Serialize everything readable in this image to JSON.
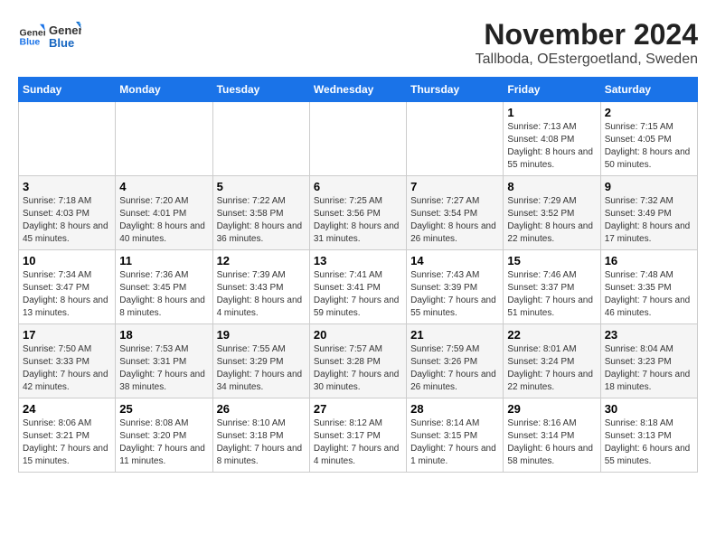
{
  "header": {
    "logo_line1": "General",
    "logo_line2": "Blue",
    "month": "November 2024",
    "location": "Tallboda, OEstergoetland, Sweden"
  },
  "weekdays": [
    "Sunday",
    "Monday",
    "Tuesday",
    "Wednesday",
    "Thursday",
    "Friday",
    "Saturday"
  ],
  "weeks": [
    [
      {
        "day": "",
        "info": ""
      },
      {
        "day": "",
        "info": ""
      },
      {
        "day": "",
        "info": ""
      },
      {
        "day": "",
        "info": ""
      },
      {
        "day": "",
        "info": ""
      },
      {
        "day": "1",
        "info": "Sunrise: 7:13 AM\nSunset: 4:08 PM\nDaylight: 8 hours and 55 minutes."
      },
      {
        "day": "2",
        "info": "Sunrise: 7:15 AM\nSunset: 4:05 PM\nDaylight: 8 hours and 50 minutes."
      }
    ],
    [
      {
        "day": "3",
        "info": "Sunrise: 7:18 AM\nSunset: 4:03 PM\nDaylight: 8 hours and 45 minutes."
      },
      {
        "day": "4",
        "info": "Sunrise: 7:20 AM\nSunset: 4:01 PM\nDaylight: 8 hours and 40 minutes."
      },
      {
        "day": "5",
        "info": "Sunrise: 7:22 AM\nSunset: 3:58 PM\nDaylight: 8 hours and 36 minutes."
      },
      {
        "day": "6",
        "info": "Sunrise: 7:25 AM\nSunset: 3:56 PM\nDaylight: 8 hours and 31 minutes."
      },
      {
        "day": "7",
        "info": "Sunrise: 7:27 AM\nSunset: 3:54 PM\nDaylight: 8 hours and 26 minutes."
      },
      {
        "day": "8",
        "info": "Sunrise: 7:29 AM\nSunset: 3:52 PM\nDaylight: 8 hours and 22 minutes."
      },
      {
        "day": "9",
        "info": "Sunrise: 7:32 AM\nSunset: 3:49 PM\nDaylight: 8 hours and 17 minutes."
      }
    ],
    [
      {
        "day": "10",
        "info": "Sunrise: 7:34 AM\nSunset: 3:47 PM\nDaylight: 8 hours and 13 minutes."
      },
      {
        "day": "11",
        "info": "Sunrise: 7:36 AM\nSunset: 3:45 PM\nDaylight: 8 hours and 8 minutes."
      },
      {
        "day": "12",
        "info": "Sunrise: 7:39 AM\nSunset: 3:43 PM\nDaylight: 8 hours and 4 minutes."
      },
      {
        "day": "13",
        "info": "Sunrise: 7:41 AM\nSunset: 3:41 PM\nDaylight: 7 hours and 59 minutes."
      },
      {
        "day": "14",
        "info": "Sunrise: 7:43 AM\nSunset: 3:39 PM\nDaylight: 7 hours and 55 minutes."
      },
      {
        "day": "15",
        "info": "Sunrise: 7:46 AM\nSunset: 3:37 PM\nDaylight: 7 hours and 51 minutes."
      },
      {
        "day": "16",
        "info": "Sunrise: 7:48 AM\nSunset: 3:35 PM\nDaylight: 7 hours and 46 minutes."
      }
    ],
    [
      {
        "day": "17",
        "info": "Sunrise: 7:50 AM\nSunset: 3:33 PM\nDaylight: 7 hours and 42 minutes."
      },
      {
        "day": "18",
        "info": "Sunrise: 7:53 AM\nSunset: 3:31 PM\nDaylight: 7 hours and 38 minutes."
      },
      {
        "day": "19",
        "info": "Sunrise: 7:55 AM\nSunset: 3:29 PM\nDaylight: 7 hours and 34 minutes."
      },
      {
        "day": "20",
        "info": "Sunrise: 7:57 AM\nSunset: 3:28 PM\nDaylight: 7 hours and 30 minutes."
      },
      {
        "day": "21",
        "info": "Sunrise: 7:59 AM\nSunset: 3:26 PM\nDaylight: 7 hours and 26 minutes."
      },
      {
        "day": "22",
        "info": "Sunrise: 8:01 AM\nSunset: 3:24 PM\nDaylight: 7 hours and 22 minutes."
      },
      {
        "day": "23",
        "info": "Sunrise: 8:04 AM\nSunset: 3:23 PM\nDaylight: 7 hours and 18 minutes."
      }
    ],
    [
      {
        "day": "24",
        "info": "Sunrise: 8:06 AM\nSunset: 3:21 PM\nDaylight: 7 hours and 15 minutes."
      },
      {
        "day": "25",
        "info": "Sunrise: 8:08 AM\nSunset: 3:20 PM\nDaylight: 7 hours and 11 minutes."
      },
      {
        "day": "26",
        "info": "Sunrise: 8:10 AM\nSunset: 3:18 PM\nDaylight: 7 hours and 8 minutes."
      },
      {
        "day": "27",
        "info": "Sunrise: 8:12 AM\nSunset: 3:17 PM\nDaylight: 7 hours and 4 minutes."
      },
      {
        "day": "28",
        "info": "Sunrise: 8:14 AM\nSunset: 3:15 PM\nDaylight: 7 hours and 1 minute."
      },
      {
        "day": "29",
        "info": "Sunrise: 8:16 AM\nSunset: 3:14 PM\nDaylight: 6 hours and 58 minutes."
      },
      {
        "day": "30",
        "info": "Sunrise: 8:18 AM\nSunset: 3:13 PM\nDaylight: 6 hours and 55 minutes."
      }
    ]
  ]
}
